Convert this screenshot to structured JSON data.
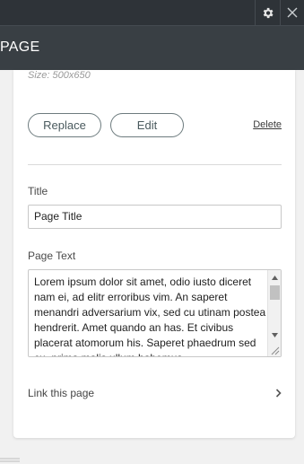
{
  "header": {
    "title": "PAGE",
    "settings_icon": "gear-icon",
    "close_icon": "close-icon"
  },
  "image": {
    "size_note": "Size: 500x650",
    "replace_label": "Replace",
    "edit_label": "Edit",
    "delete_label": "Delete"
  },
  "title_field": {
    "label": "Title",
    "value": "Page Title"
  },
  "text_field": {
    "label": "Page Text",
    "value": "Lorem ipsum dolor sit amet, odio iusto diceret nam ei, ad elitr erroribus vim. An saperet menandri adversarium vix, sed cu utinam postea hendrerit. Amet quando an has. Et civibus placerat atomorum his. Saperet phaedrum sed cu, prima malis ullum habemus"
  },
  "link": {
    "label": "Link this page",
    "icon": "chevron-right-icon"
  },
  "colors": {
    "topbar": "#2e3338",
    "titlebar": "#393f44",
    "background": "#f1f1f1"
  }
}
